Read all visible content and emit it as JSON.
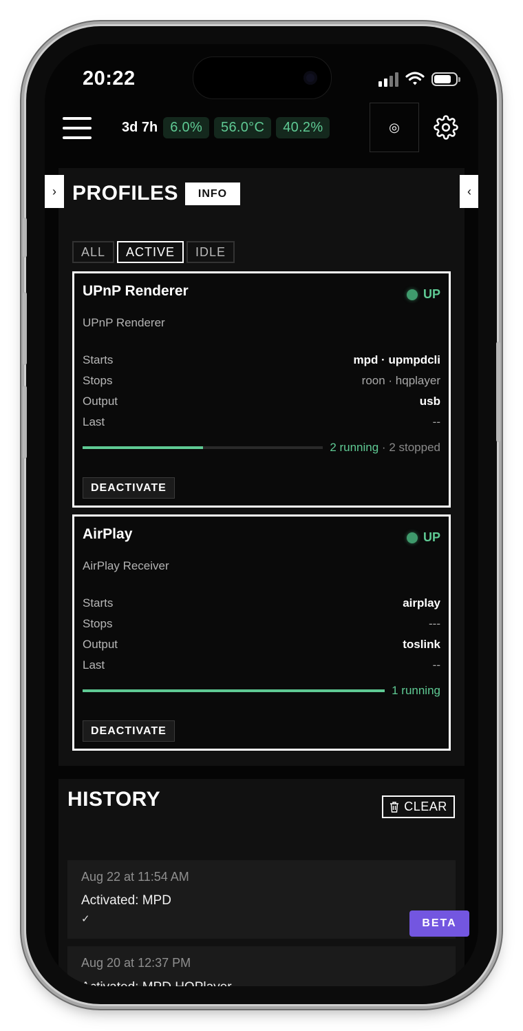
{
  "status_bar": {
    "time": "20:22"
  },
  "header": {
    "uptime": "3d 7h",
    "chips": [
      "6.0%",
      "56.0°C",
      "40.2%"
    ],
    "target_icon": "◎"
  },
  "profiles": {
    "title": "PROFILES",
    "info_label": "INFO",
    "left_arrow": "›",
    "right_arrow": "‹",
    "filters": [
      "ALL",
      "ACTIVE",
      "IDLE"
    ],
    "cards": [
      {
        "title": "UPnP Renderer",
        "subtitle": "UPnP Renderer",
        "status": "UP",
        "rows": [
          {
            "key": "Starts",
            "value": "mpd · upmpdcli"
          },
          {
            "key": "Stops",
            "value": "roon · hqplayer"
          },
          {
            "key": "Output",
            "value": "usb"
          },
          {
            "key": "Last",
            "value": "--"
          }
        ],
        "running": "2 running",
        "separator": " · ",
        "stopped": "2 stopped",
        "progress": 0.5,
        "action": "DEACTIVATE"
      },
      {
        "title": "AirPlay",
        "subtitle": "AirPlay Receiver",
        "status": "UP",
        "rows": [
          {
            "key": "Starts",
            "value": "airplay"
          },
          {
            "key": "Stops",
            "value": "---"
          },
          {
            "key": "Output",
            "value": "toslink"
          },
          {
            "key": "Last",
            "value": "--"
          }
        ],
        "running": "1 running",
        "progress": 1.0,
        "action": "DEACTIVATE"
      }
    ]
  },
  "history": {
    "title": "HISTORY",
    "clear_label": "CLEAR",
    "items": [
      {
        "date": "Aug 22 at 11:54 AM",
        "text": "Activated: MPD",
        "check": "✓"
      },
      {
        "date": "Aug 20 at 12:37 PM",
        "text": "Activated: MPD HQPlayer"
      }
    ]
  },
  "beta_label": "BETA"
}
